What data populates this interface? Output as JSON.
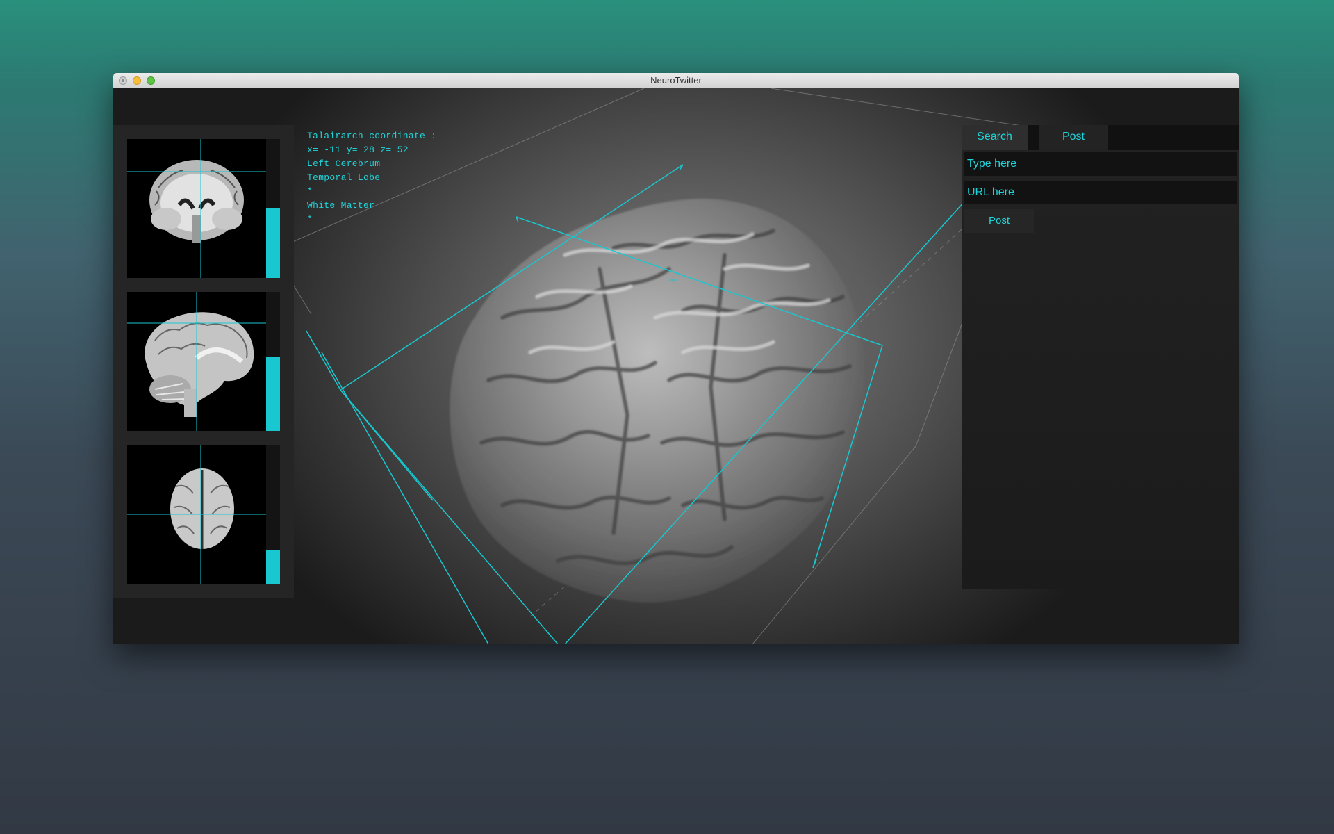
{
  "window": {
    "title": "NeuroTwitter"
  },
  "coordinate_panel": {
    "heading": "Talairarch coordinate :",
    "coords": "x= -11 y= 28 z= 52",
    "lines": [
      "Left Cerebrum",
      "Temporal Lobe",
      "*",
      "White Matter",
      "*"
    ]
  },
  "slices": [
    {
      "view": "coronal",
      "slider_level": 0.5
    },
    {
      "view": "sagittal",
      "slider_level": 0.53
    },
    {
      "view": "axial",
      "slider_level": 0.24
    }
  ],
  "post_panel": {
    "tabs": [
      {
        "label": "Search",
        "active": false
      },
      {
        "label": "Post",
        "active": true
      }
    ],
    "text_placeholder": "Type here",
    "url_placeholder": "URL here",
    "post_button": "Post"
  },
  "colors": {
    "accent": "#18c7cf",
    "panel": "#1c1c1c"
  }
}
